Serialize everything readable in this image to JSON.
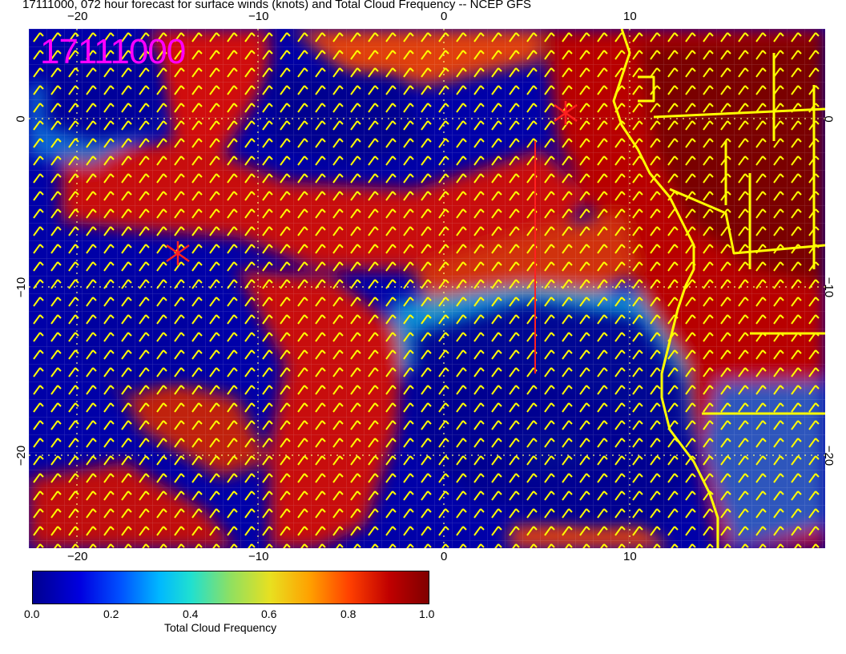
{
  "title": "17111000, 072 hour forecast for surface winds (knots) and Total Cloud Frequency -- NCEP GFS",
  "stamp": "17111000",
  "axes": {
    "top_ticks": [
      "−20",
      "−10",
      "0",
      "10"
    ],
    "bottom_ticks": [
      "−20",
      "−10",
      "0",
      "10"
    ],
    "left_ticks": [
      "0",
      "−10",
      "−20"
    ],
    "right_ticks": [
      "0",
      "−10",
      "−20"
    ]
  },
  "colorbar": {
    "ticks": [
      "0.0",
      "0.2",
      "0.4",
      "0.6",
      "0.8",
      "1.0"
    ],
    "label": "Total Cloud Frequency",
    "range": [
      0.0,
      1.0
    ]
  },
  "colors": {
    "stamp": "#ff00ff",
    "coastline": "#ffff00",
    "wind_barbs": "#ffff00",
    "markers": "#ff0000"
  },
  "map_extent": {
    "lon": [
      -22.5,
      20
    ],
    "lat": [
      -25,
      5
    ]
  }
}
